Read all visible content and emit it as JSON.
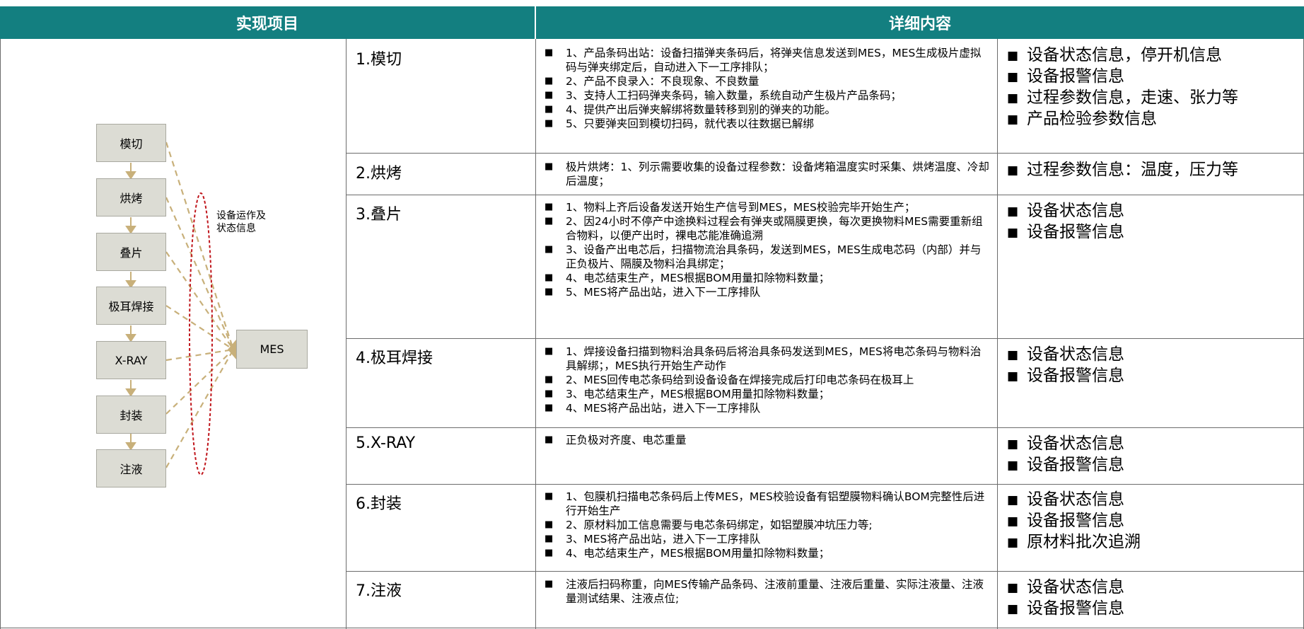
{
  "header": {
    "left": "实现项目",
    "right": "详细内容"
  },
  "flow": {
    "steps": [
      "模切",
      "烘烤",
      "叠片",
      "极耳焊接",
      "X-RAY",
      "封装",
      "注液"
    ],
    "target": "MES",
    "note": "设备运作及\n状态信息"
  },
  "rows": [
    {
      "name": "1.模切",
      "details": [
        "1、产品条码出站：设备扫描弹夹条码后，将弹夹信息发送到MES，MES生成极片虚拟码与弹夹绑定后，自动进入下一工序排队；",
        "2、产品不良录入：不良现象、不良数量",
        "3、支持人工扫码弹夹条码，输入数量，系统自动产生极片产品条码；",
        "4、提供产出后弹夹解绑将数量转移到别的弹夹的功能。",
        "5、只要弹夹回到模切扫码，就代表以往数据已解绑"
      ],
      "info": [
        "设备状态信息，停开机信息",
        "设备报警信息",
        "过程参数信息，走速、张力等",
        "产品检验参数信息"
      ]
    },
    {
      "name": "2.烘烤",
      "details": [
        "极片烘烤：1、列示需要收集的设备过程参数：设备烤箱温度实时采集、烘烤温度、冷却后温度；"
      ],
      "info": [
        "过程参数信息：温度，压力等"
      ]
    },
    {
      "name": "3.叠片",
      "details": [
        "1、物料上齐后设备发送开始生产信号到MES，MES校验完毕开始生产；",
        "2、因24小时不停产中途换料过程会有弹夹或隔膜更换，每次更换物料MES需要重新组合物料，以便产出时，裸电芯能准确追溯",
        "3、设备产出电芯后，扫描物流治具条码，发送到MES，MES生成电芯码（内部）并与正负极片、隔膜及物料治具绑定；",
        "4、电芯结束生产，MES根据BOM用量扣除物料数量；",
        "5、MES将产品出站，进入下一工序排队"
      ],
      "info": [
        "设备状态信息",
        "设备报警信息"
      ]
    },
    {
      "name": "4.极耳焊接",
      "details": [
        "1、焊接设备扫描到物料治具条码后将治具条码发送到MES，MES将电芯条码与物料治具解绑；，MES执行开始生产动作",
        "2、MES回传电芯条码给到设备设备在焊接完成后打印电芯条码在极耳上",
        "3、电芯结束生产，MES根据BOM用量扣除物料数量；",
        "4、MES将产品出站，进入下一工序排队"
      ],
      "info": [
        "设备状态信息",
        "设备报警信息"
      ]
    },
    {
      "name": "5.X-RAY",
      "details": [
        "正负极对齐度、电芯重量"
      ],
      "info": [
        "设备状态信息",
        "设备报警信息"
      ]
    },
    {
      "name": "6.封装",
      "details": [
        "1、包膜机扫描电芯条码后上传MES，MES校验设备有铝塑膜物料确认BOM完整性后进行开始生产",
        "2、原材料加工信息需要与电芯条码绑定，如铝塑膜冲坑压力等;",
        "3、MES将产品出站，进入下一工序排队",
        "4、电芯结束生产，MES根据BOM用量扣除物料数量；"
      ],
      "info": [
        "设备状态信息",
        "设备报警信息",
        "原材料批次追溯"
      ]
    },
    {
      "name": "7.注液",
      "details": [
        "注液后扫码称重，向MES传输产品条码、注液前重量、注液后重量、实际注液量、注液量测试结果、注液点位;"
      ],
      "info": [
        "设备状态信息",
        "设备报警信息"
      ]
    }
  ],
  "colors": {
    "header": "#137f80",
    "box": "#dcdcd4",
    "dash": "#c8b07a",
    "ellipse": "#c0161c"
  }
}
